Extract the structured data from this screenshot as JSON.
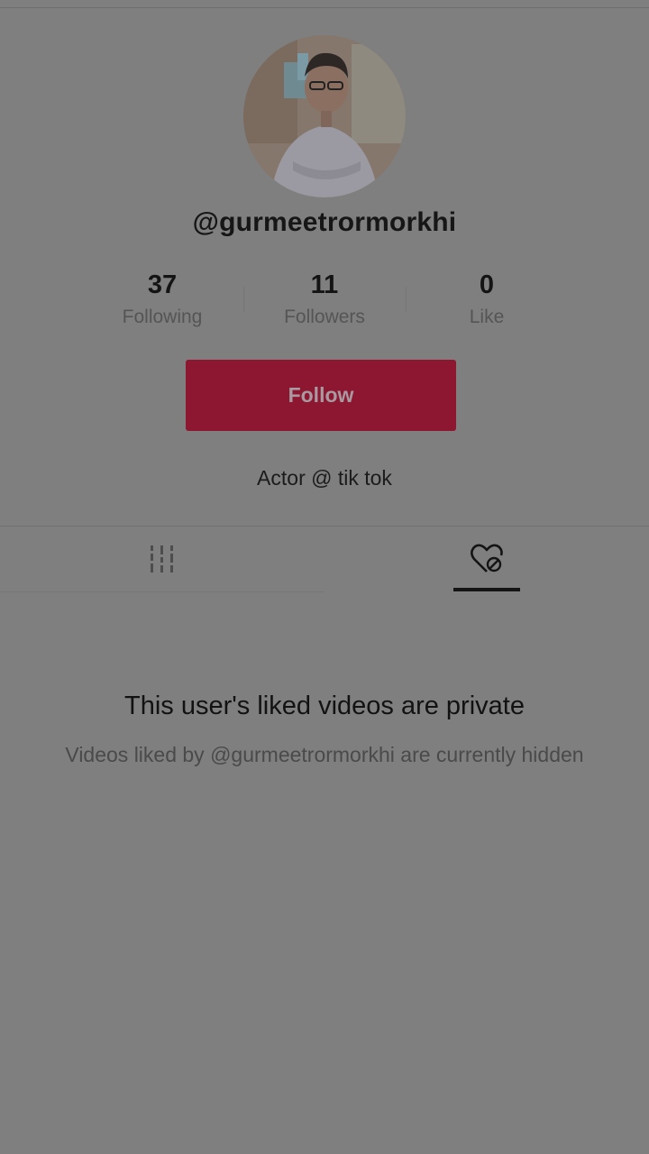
{
  "profile": {
    "username": "@gurmeetrormorkhi",
    "bio": "Actor @ tik tok",
    "avatar_alt": "profile photo"
  },
  "stats": [
    {
      "value": "37",
      "label": "Following"
    },
    {
      "value": "11",
      "label": "Followers"
    },
    {
      "value": "0",
      "label": "Like"
    }
  ],
  "actions": {
    "follow_label": "Follow"
  },
  "tabs": [
    {
      "name": "videos",
      "icon": "grid-icon",
      "active": false
    },
    {
      "name": "liked",
      "icon": "liked-private-heart-icon",
      "active": true
    }
  ],
  "empty_state": {
    "title": "This user's liked videos are private",
    "description": "Videos liked by @gurmeetrormorkhi are currently hidden"
  },
  "colors": {
    "background": "#7f7f7f",
    "follow_button": "#8d1630",
    "text_primary": "#141414"
  }
}
